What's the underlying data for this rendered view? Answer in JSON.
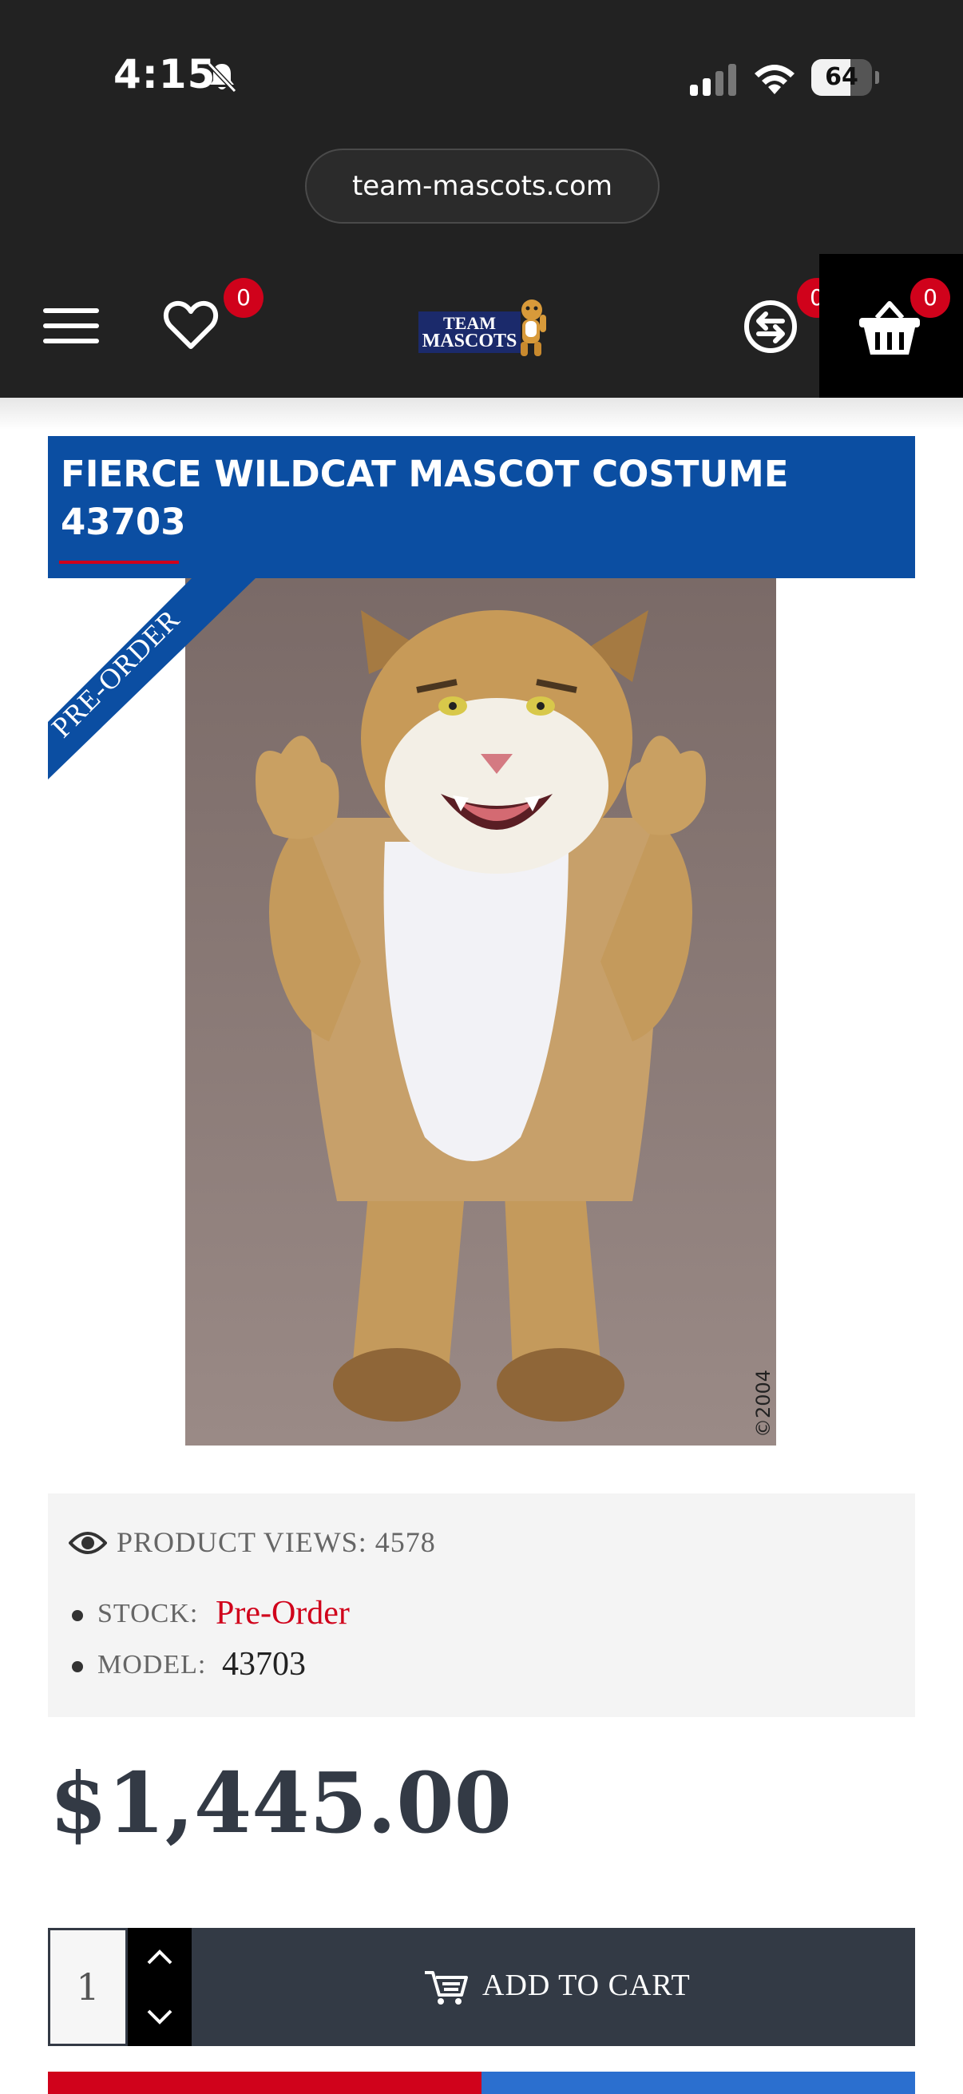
{
  "status_bar": {
    "time": "4:15",
    "battery_level": "64",
    "battery_fraction": 0.64
  },
  "browser": {
    "url": "team-mascots.com"
  },
  "header": {
    "wishlist_count": "0",
    "compare_count": "0",
    "cart_count": "0",
    "logo": {
      "line1": "TEAM",
      "line2": "MASCOTS"
    }
  },
  "product": {
    "title": "FIERCE WILDCAT MASCOT COSTUME 43703",
    "ribbon": "PRE-ORDER",
    "image_copyright": "©2004",
    "views_label": "PRODUCT VIEWS:",
    "views_value": "4578",
    "stock_label": "STOCK:",
    "stock_value": "Pre-Order",
    "model_label": "MODEL:",
    "model_value": "43703",
    "price": "$1,445.00"
  },
  "cart": {
    "quantity": "1",
    "add_label": "ADD TO CART"
  },
  "colors": {
    "header_bg": "#222222",
    "title_bg": "#0b4ea2",
    "accent_red": "#d0021b",
    "button_dark": "#333a45"
  }
}
